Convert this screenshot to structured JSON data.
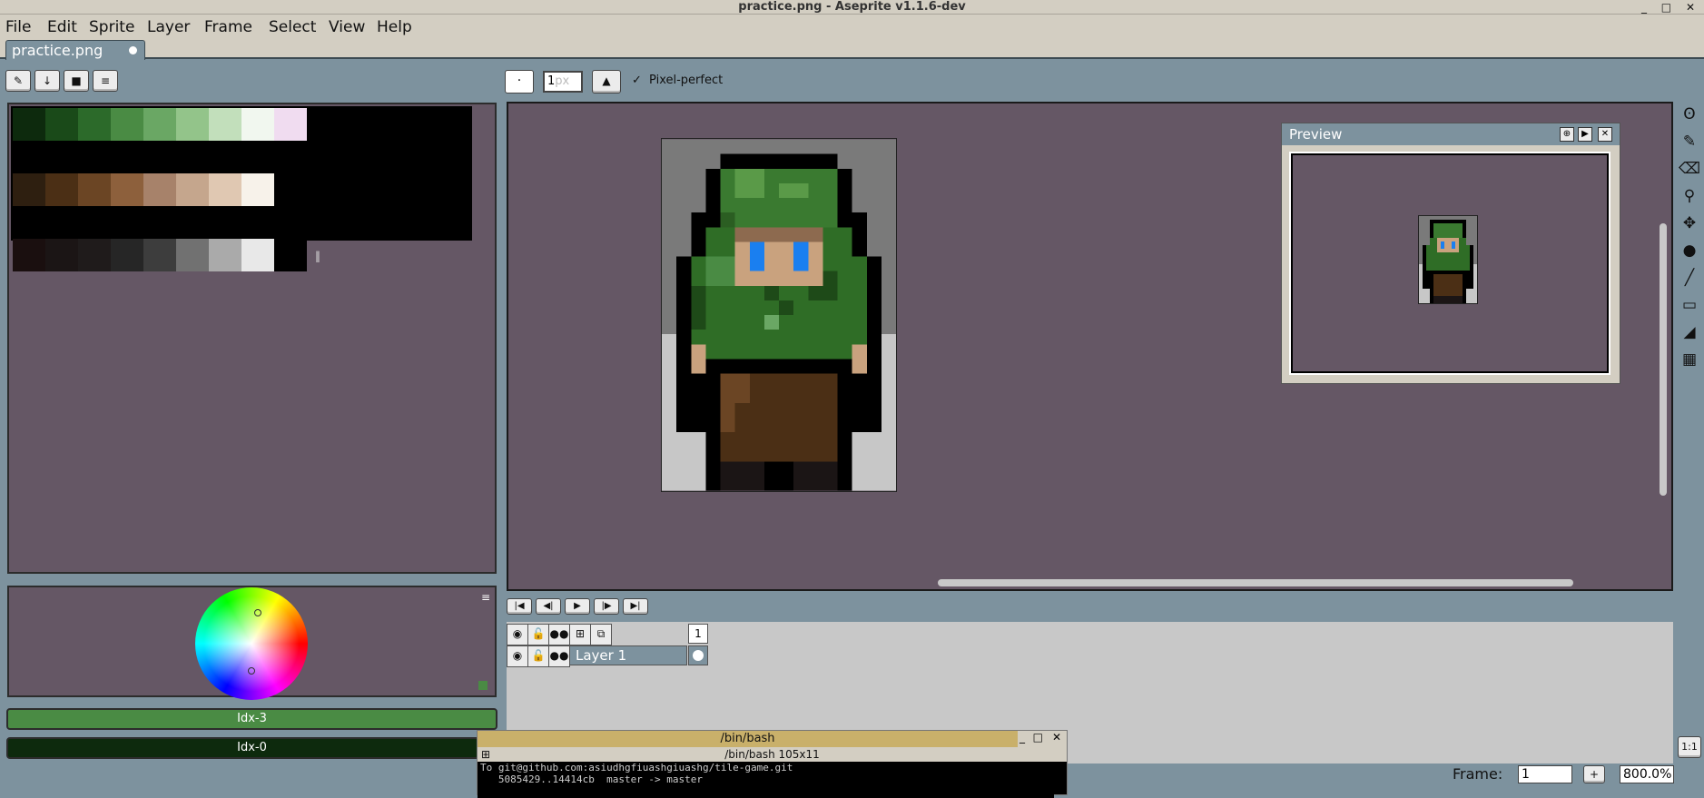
{
  "window": {
    "title": "practice.png - Aseprite v1.1.6-dev",
    "controls": [
      "_",
      "□",
      "✕"
    ]
  },
  "menu": [
    "File",
    "Edit",
    "Sprite",
    "Layer",
    "Frame",
    "Select",
    "View",
    "Help"
  ],
  "tab": {
    "label": "practice.png"
  },
  "palette_toolbar": [
    "edit-icon",
    "sort-icon",
    "save-icon",
    "menu-icon"
  ],
  "toolbar": {
    "brush_size_value": "1",
    "brush_size_unit": "px",
    "pixel_perfect_label": "Pixel-perfect",
    "pixel_perfect_checked": true
  },
  "palette": {
    "row1": [
      "#0d2a0d",
      "#1a4a19",
      "#2c6a2a",
      "#4a8b44",
      "#6aa764",
      "#93c48a",
      "#c2dfbb",
      "#f1f7ef",
      "#f0dcf0"
    ],
    "row2": [
      "#2e1f10",
      "#4b2f15",
      "#6b4524",
      "#8d603c",
      "#a7826a",
      "#c5a68d",
      "#e0c8b2",
      "#f7f2ea"
    ],
    "row3": [
      "#1a0f0f",
      "#1b1515",
      "#1f1b1b",
      "#262626",
      "#3d3d3d",
      "#717171",
      "#aaaaaa",
      "#e8e8e8",
      "#000000"
    ]
  },
  "idx_fg": "Idx-3",
  "idx_bg": "Idx-0",
  "idx_fg_color": "#4a8b44",
  "idx_bg_color": "#0d2a0d",
  "preview": {
    "title": "Preview"
  },
  "timeline": {
    "frame_header": "1",
    "layer_name": "Layer 1"
  },
  "terminal": {
    "title": "/bin/bash",
    "subtitle": "/bin/bash 105x11",
    "lines": [
      "To git@github.com:asiudhgfiuashgiuashg/tile-game.git",
      "   5085429..14414cb  master -> master"
    ]
  },
  "status": {
    "frame_label": "Frame:",
    "frame_value": "1",
    "zoom_value": "800.0%",
    "zoom_reset_label": "1:1"
  },
  "tools": [
    "lasso-icon",
    "pencil-icon",
    "eraser-icon",
    "zoom-icon",
    "move-icon",
    "paint-bucket-icon",
    "line-icon",
    "rectangle-icon",
    "curve-icon",
    "spray-icon"
  ]
}
